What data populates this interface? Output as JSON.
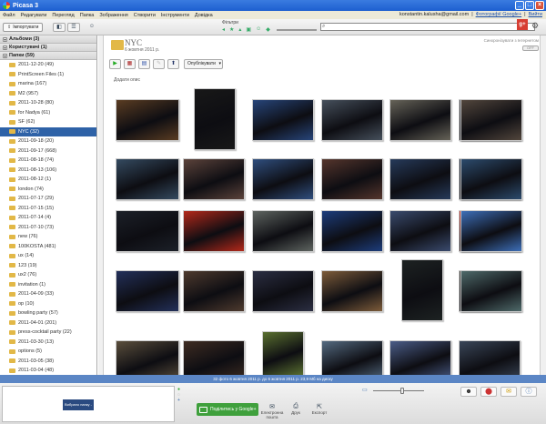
{
  "window": {
    "title": "Picasa 3"
  },
  "menu": [
    "Файл",
    "Редагувати",
    "Перегляд",
    "Папка",
    "Зображення",
    "Створити",
    "Інструменти",
    "Довідка"
  ],
  "account": {
    "email": "konstantin.kalusha@gmail.com",
    "separator": "|",
    "photos_link": "Фотографії Google+",
    "sep2": "|",
    "exit_link": "Вийти"
  },
  "toolbar": {
    "import_label": "Імпортувати",
    "filters_label": "Фільтри"
  },
  "sidebar": {
    "sections": [
      {
        "label": "Альбоми (3)"
      },
      {
        "label": "Користувачі (1)"
      },
      {
        "label": "Папки (59)"
      }
    ],
    "folders": [
      "2011-12-20 (49)",
      "PrintScreen Files (1)",
      "marina (167)",
      "M2 (957)",
      "2011-10-28 (80)",
      "for Nadya (61)",
      "SF (62)",
      "NYC (32)",
      "2011-09-18 (20)",
      "2011-09-17 (668)",
      "2011-08-18 (74)",
      "2011-08-13 (106)",
      "2011-08-12 (1)",
      "london (74)",
      "2011-07-17 (29)",
      "2011-07-15 (15)",
      "2011-07-14 (4)",
      "2011-07-10 (73)",
      "new (76)",
      "100KOSTA (481)",
      "ux (14)",
      "123 (19)",
      "ux2 (76)",
      "invitation (1)",
      "2011-04-09 (33)",
      "op (10)",
      "bowling party (57)",
      "2011-04-01 (201)",
      "press-cocktail party (22)",
      "2011-03-30 (13)",
      "options (5)",
      "2011-03-05 (38)",
      "2011-03-04 (48)"
    ],
    "selected_index": 7
  },
  "album": {
    "title": "NYC",
    "date": "6 жовтня 2011 р.",
    "sync_label": "Синхронізувати з Інтернетом",
    "sync_toggle": "OFF",
    "publish_label": "Опублікувати",
    "add_description": "Додати опис"
  },
  "photos": [
    {
      "c": "#5a3c22"
    },
    {
      "c": "#181818"
    },
    {
      "c": "#27457a"
    },
    {
      "c": "#46505c"
    },
    {
      "c": "#666358"
    },
    {
      "c": "#4a4a4e"
    },
    {
      "c": "#52463c"
    },
    {
      "c": "#344a60"
    },
    {
      "c": "#5b423a"
    },
    {
      "c": "#2f4e7e"
    },
    {
      "c": "#55352c"
    },
    {
      "c": "#263a5a"
    },
    {
      "c": "#131f33"
    },
    {
      "c": "#2c4b6d"
    },
    {
      "c": "#1c2028"
    },
    {
      "c": "#b3281a"
    },
    {
      "c": "#5e6460"
    },
    {
      "c": "#1d3d7c"
    },
    {
      "c": "#3a4b6e"
    },
    {
      "c": "#c03128"
    },
    {
      "c": "#3d6fb8"
    },
    {
      "c": "#23305a"
    },
    {
      "c": "#4e3a2e"
    },
    {
      "c": "#2b2e42"
    },
    {
      "c": "#7d5c3a"
    },
    {
      "c": "#1d2222"
    },
    {
      "c": "#3a3a36"
    },
    {
      "c": "#4f6a6a"
    },
    {
      "c": "#5a4e3c"
    },
    {
      "c": "#3e2c22"
    },
    {
      "c": "#5a7030"
    },
    {
      "c": "#546a80"
    },
    {
      "c": "#4b5d88"
    },
    {
      "c": "#3a4658"
    }
  ],
  "status": {
    "text": "32 фото   6 жовтня 2011 р. до 6 жовтня 2011 р.   23,9 Мб на диску"
  },
  "tray": {
    "selected_label": "Вибрано папку - 32 фото",
    "share_label": "Поділитись у Google+",
    "email_label": "Електронна пошта",
    "print_label": "Друк",
    "export_label": "Експорт"
  }
}
